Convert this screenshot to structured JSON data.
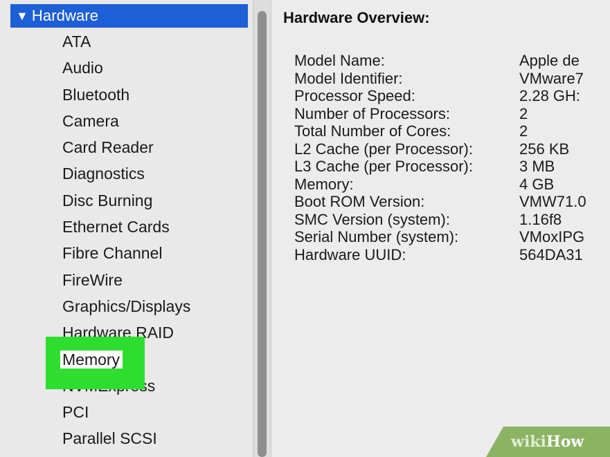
{
  "sidebar": {
    "header_label": "Hardware",
    "header_arrow": "▼",
    "items": [
      {
        "label": "ATA"
      },
      {
        "label": "Audio"
      },
      {
        "label": "Bluetooth"
      },
      {
        "label": "Camera"
      },
      {
        "label": "Card Reader"
      },
      {
        "label": "Diagnostics"
      },
      {
        "label": "Disc Burning"
      },
      {
        "label": "Ethernet Cards"
      },
      {
        "label": "Fibre Channel"
      },
      {
        "label": "FireWire"
      },
      {
        "label": "Graphics/Displays"
      },
      {
        "label": "Hardware RAID"
      },
      {
        "label": "Memory"
      },
      {
        "label": "NVMExpress"
      },
      {
        "label": "PCI"
      },
      {
        "label": "Parallel SCSI"
      }
    ],
    "selected_item": "Memory",
    "selection_color": "#1d5fd6",
    "highlight_color": "#2ede2e"
  },
  "detail": {
    "title": "Hardware Overview:",
    "rows": [
      {
        "key": "Model Name:",
        "value": "Apple de"
      },
      {
        "key": "Model Identifier:",
        "value": "VMware7"
      },
      {
        "key": "Processor Speed:",
        "value": "2.28 GH:"
      },
      {
        "key": "Number of Processors:",
        "value": "2"
      },
      {
        "key": "Total Number of Cores:",
        "value": "2"
      },
      {
        "key": "L2 Cache (per Processor):",
        "value": "256 KB"
      },
      {
        "key": "L3 Cache (per Processor):",
        "value": "3 MB"
      },
      {
        "key": "Memory:",
        "value": "4 GB"
      },
      {
        "key": "Boot ROM Version:",
        "value": "VMW71.0"
      },
      {
        "key": "SMC Version (system):",
        "value": "1.16f8"
      },
      {
        "key": "Serial Number (system):",
        "value": "VMoxIPG"
      },
      {
        "key": "Hardware UUID:",
        "value": "564DA31"
      }
    ]
  },
  "watermark": {
    "part1": "wiki",
    "part2": "How"
  }
}
